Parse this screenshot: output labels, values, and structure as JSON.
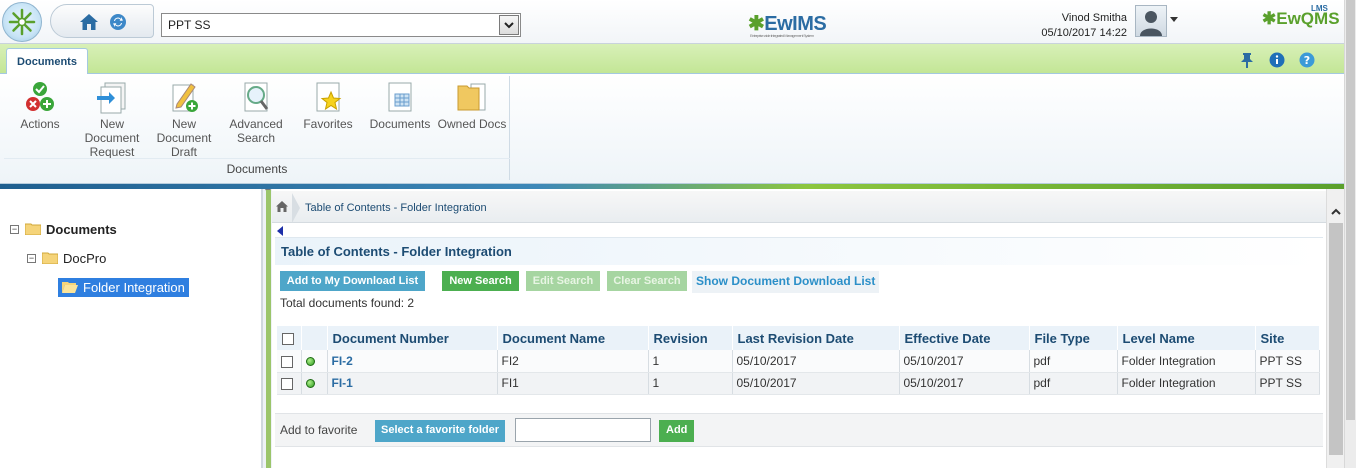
{
  "header": {
    "site_select_value": "PPT SS",
    "logo_center": "EwIMS",
    "logo_center_tagline": "Enterprise wide Integrated Management System",
    "logo_right": "EwQMS",
    "logo_right_sup": "LMS",
    "user_name": "Vinod Smitha",
    "datetime": "05/10/2017 14:22"
  },
  "ribbon": {
    "tab_label": "Documents",
    "group_label": "Documents",
    "buttons": [
      {
        "label": "Actions",
        "icon": "actions-icon"
      },
      {
        "label": "New Document Request",
        "icon": "new-document-request-icon"
      },
      {
        "label": "New Document Draft",
        "icon": "new-document-draft-icon"
      },
      {
        "label": "Advanced Search",
        "icon": "advanced-search-icon"
      },
      {
        "label": "Favorites",
        "icon": "favorites-icon"
      },
      {
        "label": "Documents",
        "icon": "documents-icon"
      },
      {
        "label": "Owned Docs",
        "icon": "owned-docs-icon"
      }
    ],
    "right_icons": [
      "pin-icon",
      "info-icon",
      "help-icon"
    ]
  },
  "tree": {
    "items": [
      {
        "label": "Documents",
        "toggle": "−"
      },
      {
        "label": "DocPro",
        "toggle": "−"
      },
      {
        "label": "Folder Integration"
      }
    ]
  },
  "content": {
    "breadcrumb": "Table of Contents - Folder Integration",
    "title": "Table of Contents - Folder Integration",
    "buttons": {
      "add_download": "Add to My Download List",
      "new_search": "New Search",
      "edit_search": "Edit Search",
      "clear_search": "Clear Search"
    },
    "show_download_link": "Show Document Download List",
    "total_found": "Total documents found: 2",
    "columns": [
      "Document Number",
      "Document Name",
      "Revision",
      "Last Revision Date",
      "Effective Date",
      "File Type",
      "Level Name",
      "Site"
    ],
    "rows": [
      {
        "number": "FI-2",
        "name": "FI2",
        "revision": "1",
        "last_revision_date": "05/10/2017",
        "effective_date": "05/10/2017",
        "file_type": "pdf",
        "level_name": "Folder Integration",
        "site": "PPT SS"
      },
      {
        "number": "FI-1",
        "name": "FI1",
        "revision": "1",
        "last_revision_date": "05/10/2017",
        "effective_date": "05/10/2017",
        "file_type": "pdf",
        "level_name": "Folder Integration",
        "site": "PPT SS"
      }
    ],
    "favorite": {
      "label": "Add to favorite",
      "select_button": "Select a favorite folder",
      "input_value": "",
      "add_button": "Add"
    }
  },
  "colors": {
    "accent_blue": "#1d4c73",
    "button_blue": "#4ea6c9",
    "button_green": "#4caf50",
    "ribbon_green": "#c3e696"
  }
}
